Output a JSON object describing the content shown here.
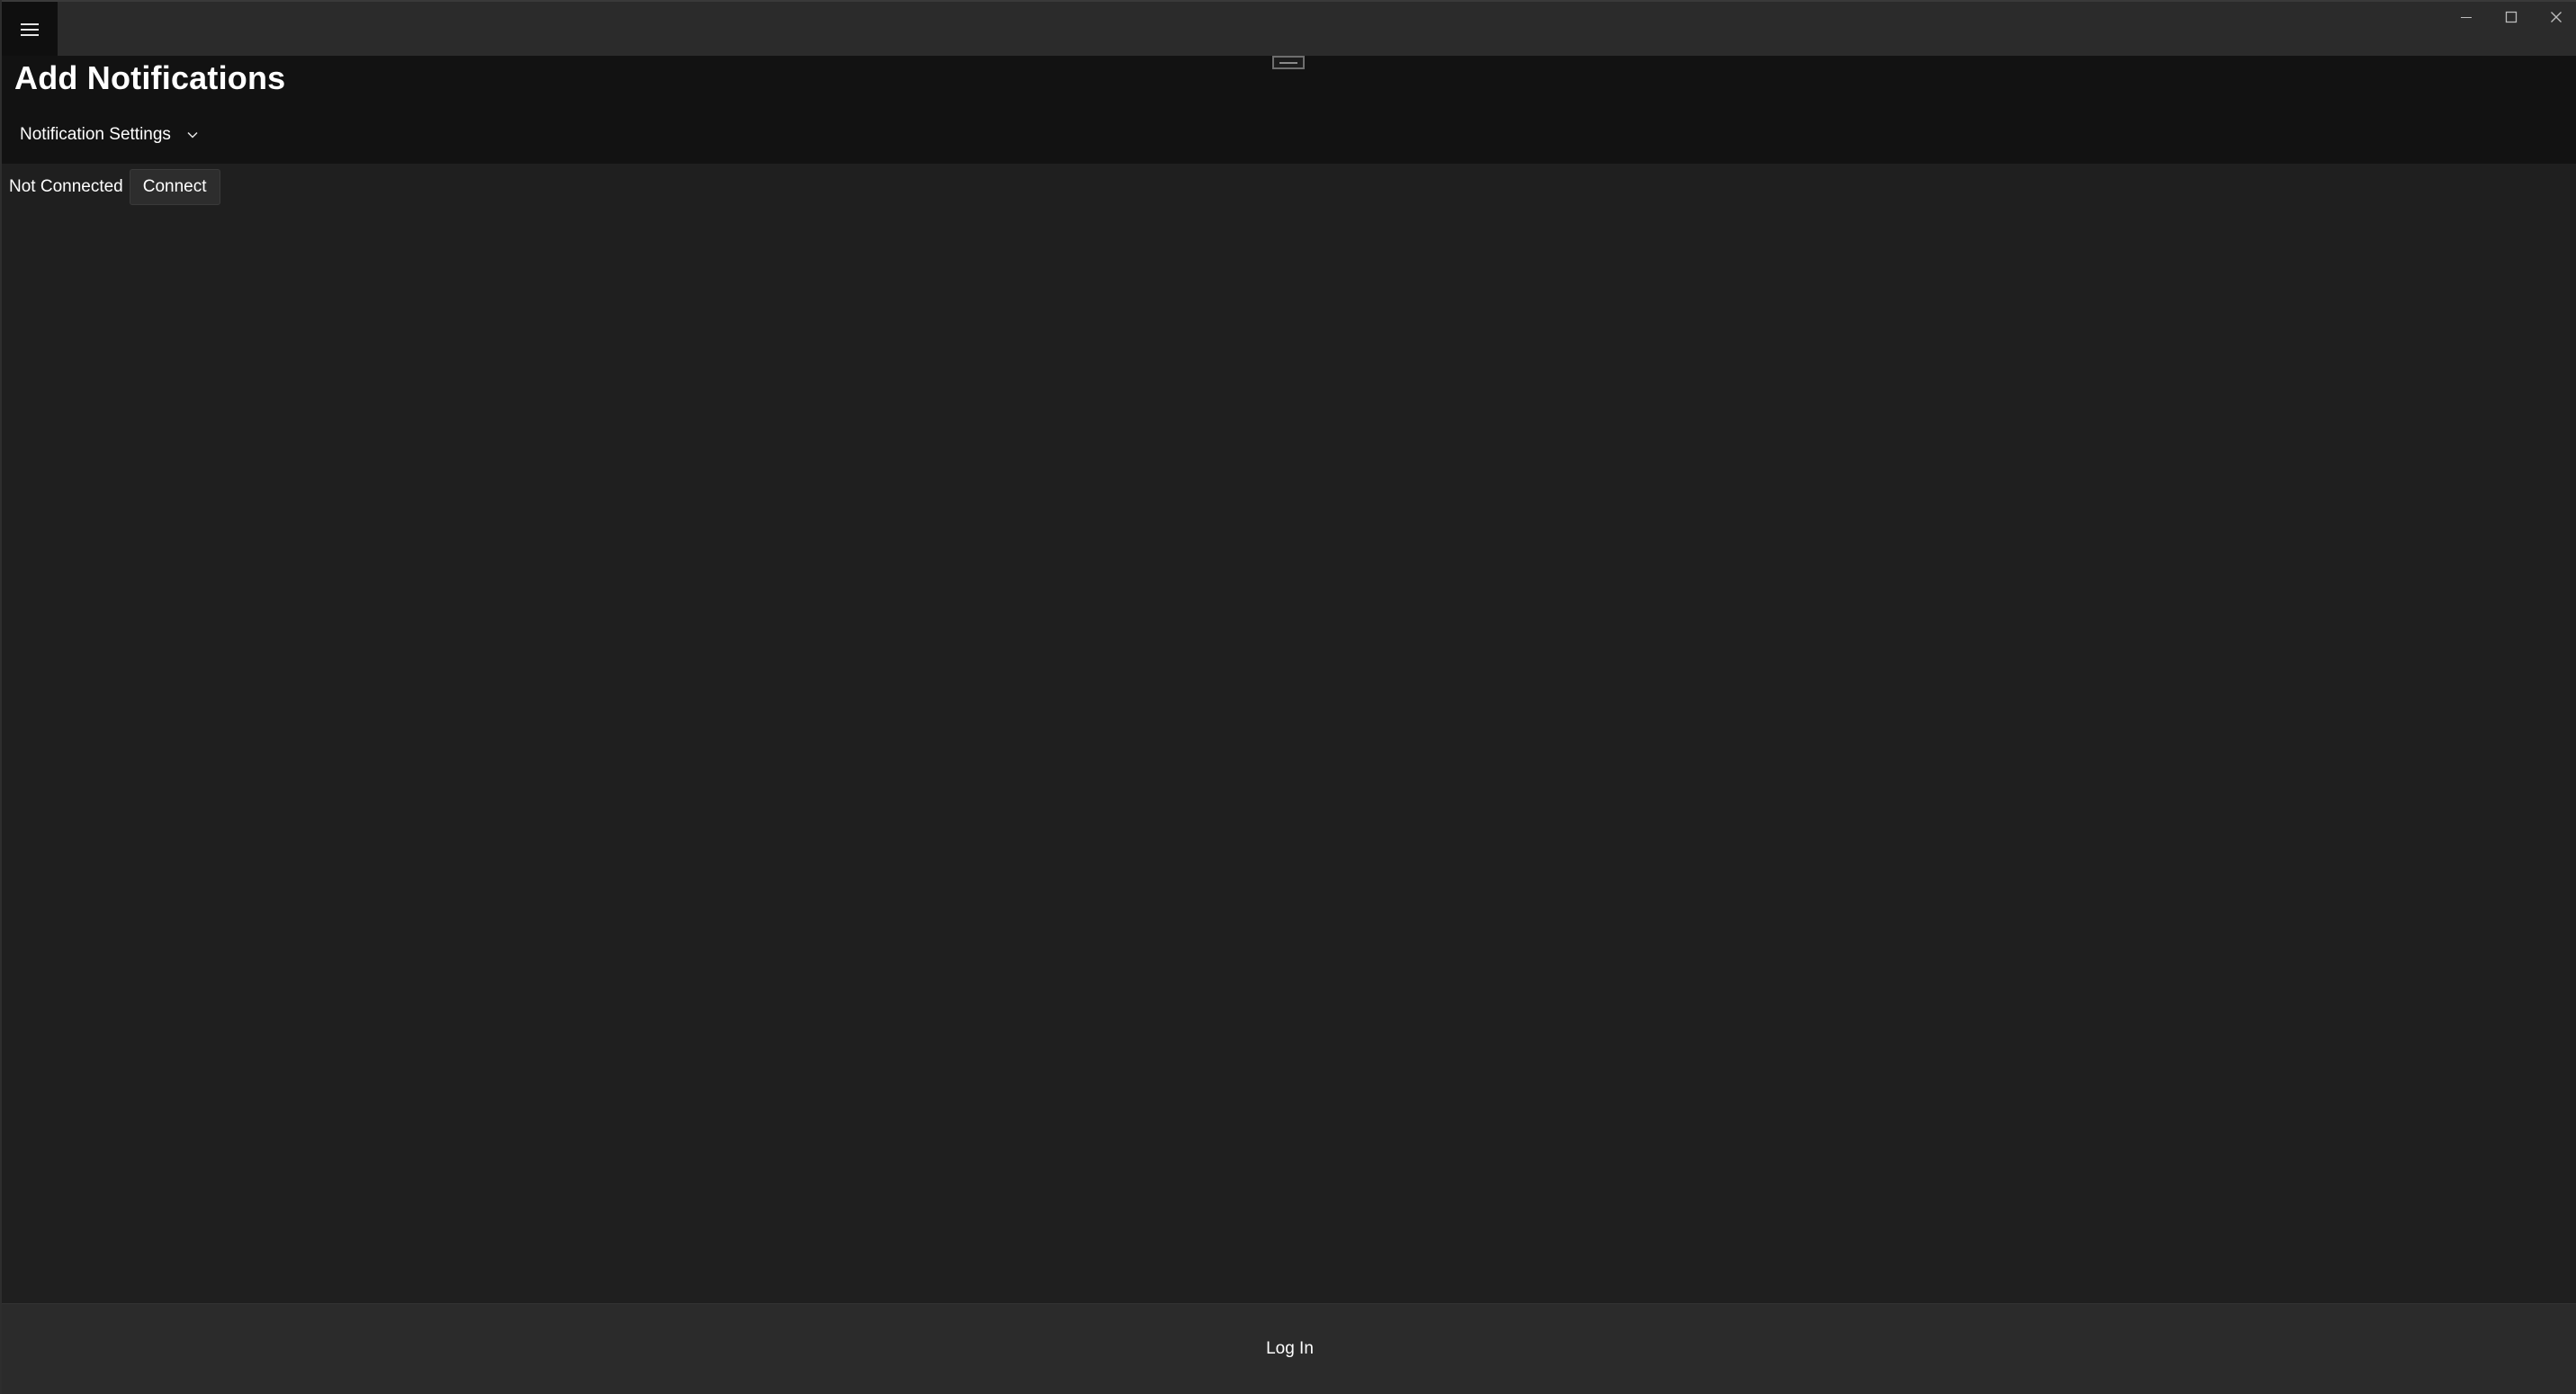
{
  "window": {
    "caption_buttons": {
      "minimize_icon": "minimize-icon",
      "maximize_icon": "maximize-icon",
      "close_icon": "close-icon"
    },
    "menu_icon": "hamburger-menu-icon"
  },
  "header": {
    "title": "Add Notifications",
    "settings_dropdown": {
      "label": "Notification Settings",
      "icon": "chevron-down-icon"
    }
  },
  "status": {
    "text": "Not Connected",
    "connect_label": "Connect"
  },
  "footer": {
    "login_label": "Log In"
  },
  "colors": {
    "background": "#1f1f1f",
    "titlebar": "#2b2b2b",
    "header": "#121212",
    "menu_button": "#0f0f0f",
    "text": "#ffffff"
  }
}
